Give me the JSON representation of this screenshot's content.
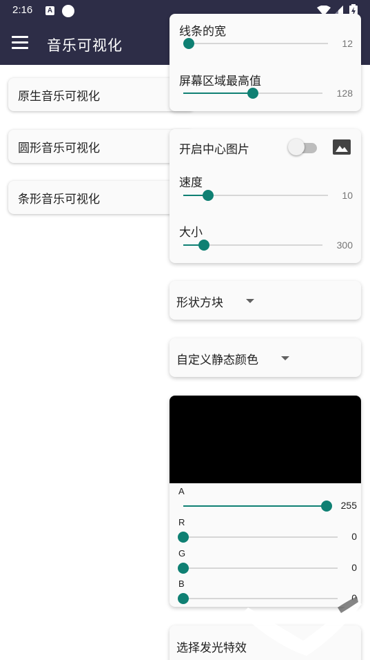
{
  "status_bar": {
    "time": "2:16",
    "a_badge": "A"
  },
  "app_bar": {
    "title": "音乐可视化"
  },
  "menu": {
    "items": [
      {
        "label": "原生音乐可视化"
      },
      {
        "label": "圆形音乐可视化"
      },
      {
        "label": "条形音乐可视化"
      }
    ]
  },
  "line_panel": {
    "line_width": {
      "label": "线条的宽",
      "value": "12",
      "fraction": 0.04
    },
    "screen_max": {
      "label": "屏幕区域最高值",
      "value": "128",
      "fraction": 0.5
    }
  },
  "center_panel": {
    "toggle_label": "开启中心图片",
    "toggle_on": false,
    "speed": {
      "label": "速度",
      "value": "10",
      "fraction": 0.17
    },
    "size": {
      "label": "大小",
      "value": "300",
      "fraction": 0.15
    }
  },
  "shape_dropdown": {
    "label": "形状方块"
  },
  "color_dropdown": {
    "label": "自定义静态颜色"
  },
  "color_picker": {
    "preview_color": "#000000",
    "channels": [
      {
        "name": "A",
        "value": "255",
        "fraction": 1.0
      },
      {
        "name": "R",
        "value": "0",
        "fraction": 0
      },
      {
        "name": "G",
        "value": "0",
        "fraction": 0
      },
      {
        "name": "B",
        "value": "0",
        "fraction": 0
      }
    ]
  },
  "glow_effect": {
    "label": "选择发光特效"
  },
  "colors": {
    "app_bar": "#2d2d47",
    "accent": "#0f8073",
    "track": "#d6d6d6"
  }
}
